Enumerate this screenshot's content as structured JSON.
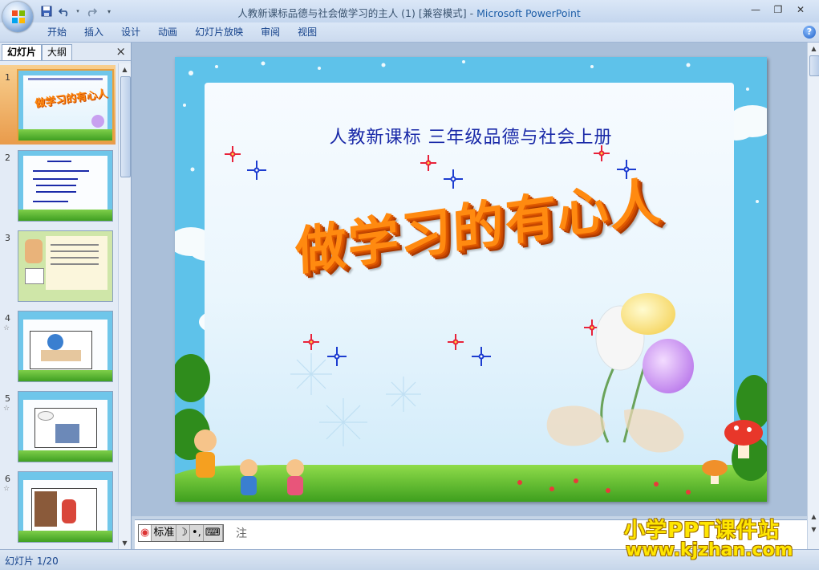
{
  "window": {
    "title_doc": "人教新课标品德与社会做学习的主人 (1) [兼容模式]",
    "title_sep": " - ",
    "title_app": "Microsoft PowerPoint"
  },
  "quick_access": [
    "save-icon",
    "undo-icon",
    "redo-icon",
    "customize-icon"
  ],
  "ribbon": {
    "tabs": [
      "开始",
      "插入",
      "设计",
      "动画",
      "幻灯片放映",
      "审阅",
      "视图"
    ]
  },
  "left_pane": {
    "tabs": [
      "幻灯片",
      "大纲"
    ],
    "close": "×",
    "slides": [
      {
        "num": "1",
        "star": ""
      },
      {
        "num": "2",
        "star": ""
      },
      {
        "num": "3",
        "star": ""
      },
      {
        "num": "4",
        "star": "☆"
      },
      {
        "num": "5",
        "star": "☆"
      },
      {
        "num": "6",
        "star": "☆"
      }
    ]
  },
  "slide": {
    "subtitle": "人教新课标 三年级品德与社会上册",
    "title": "做学习的有心人"
  },
  "notes": {
    "ime": [
      "标准",
      "☽",
      "•,",
      "⌨"
    ],
    "hint": "注"
  },
  "status": {
    "text": "幻灯片 1/20"
  },
  "watermark": {
    "line1": "小学PPT课件站",
    "line2": "www.kjzhan.com"
  },
  "colors": {
    "ribbon_bg": "#dbe7f7",
    "slide_sky": "#5ec2ea",
    "title_orange": "#ff8a10",
    "subtitle_blue": "#1a2aa8",
    "watermark_yellow": "#ffe600"
  }
}
